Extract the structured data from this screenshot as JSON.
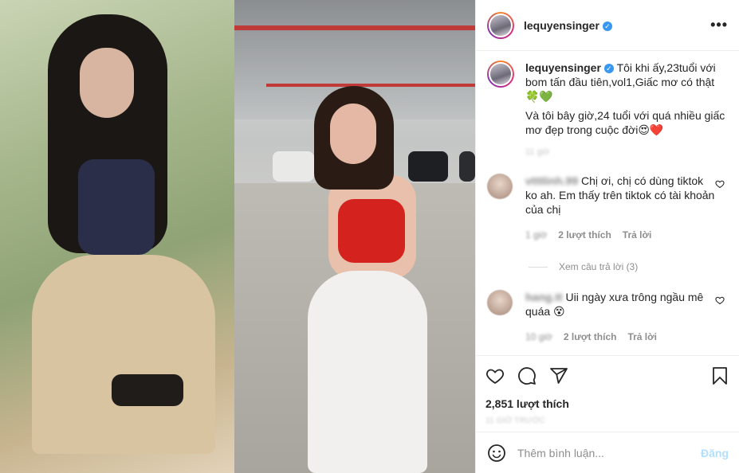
{
  "post": {
    "username": "lequyensinger",
    "verified_icon": "verified-badge-icon",
    "more_label": "•••"
  },
  "caption": {
    "username": "lequyensinger",
    "line1": "Tôi khi ấy,23tuổi với bom tấn đầu tiên,vol1,Giấc mơ có thật 🍀💚",
    "line2": "Và tôi bây giờ,24 tuổi với quá nhiều giấc mơ đẹp trong cuộc đời😍❤️",
    "time": "11 giờ"
  },
  "comments": [
    {
      "username": "vtttlinh.99",
      "text": "Chị ơi, chị có dùng tiktok ko ah. Em thấy trên tiktok có tài khoản của chị",
      "time": "1 giờ",
      "likes": "2 lượt thích",
      "reply": "Trả lời"
    },
    {
      "username": "hang.tt",
      "text": "Uii ngày xưa trông ngầu mê quáa 😵",
      "time": "10 giờ",
      "likes": "2 lượt thích",
      "reply": "Trả lời"
    }
  ],
  "view_replies": "Xem câu trả lời (3)",
  "likes_count": "2,851 lượt thích",
  "post_time": "11 GIỜ TRƯỚC",
  "comment_box": {
    "placeholder": "Thêm bình luận...",
    "post_label": "Đăng"
  },
  "icons": {
    "like": "heart-icon",
    "comment": "comment-icon",
    "share": "share-icon",
    "save": "bookmark-icon",
    "emoji": "emoji-icon"
  },
  "colors": {
    "accent": "#3897f0",
    "post_disabled": "#b2dffc",
    "text": "#262626",
    "muted": "#8e8e8e"
  }
}
